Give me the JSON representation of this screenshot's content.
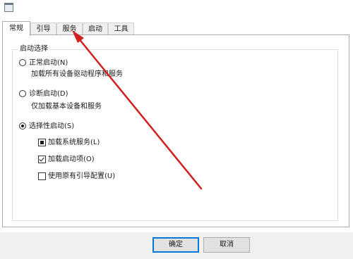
{
  "tabs": [
    "常规",
    "引导",
    "服务",
    "启动",
    "工具"
  ],
  "startup": {
    "group_title": "启动选择",
    "normal": {
      "label": "正常启动(N)",
      "desc": "加载所有设备驱动程序和服务"
    },
    "diagnostic": {
      "label": "诊断启动(D)",
      "desc": "仅加载基本设备和服务"
    },
    "selective": {
      "label": "选择性启动(S)"
    },
    "selected_mode": "selective",
    "options": [
      {
        "label": "加载系统服务(L)",
        "state": "indeterminate"
      },
      {
        "label": "加载启动项(O)",
        "state": "checked"
      },
      {
        "label": "使用原有引导配置(U)",
        "state": "unchecked"
      }
    ]
  },
  "buttons": {
    "ok": "确定",
    "cancel": "取消"
  },
  "annotation_color": "#d02020",
  "icons": [
    "app-icon"
  ]
}
